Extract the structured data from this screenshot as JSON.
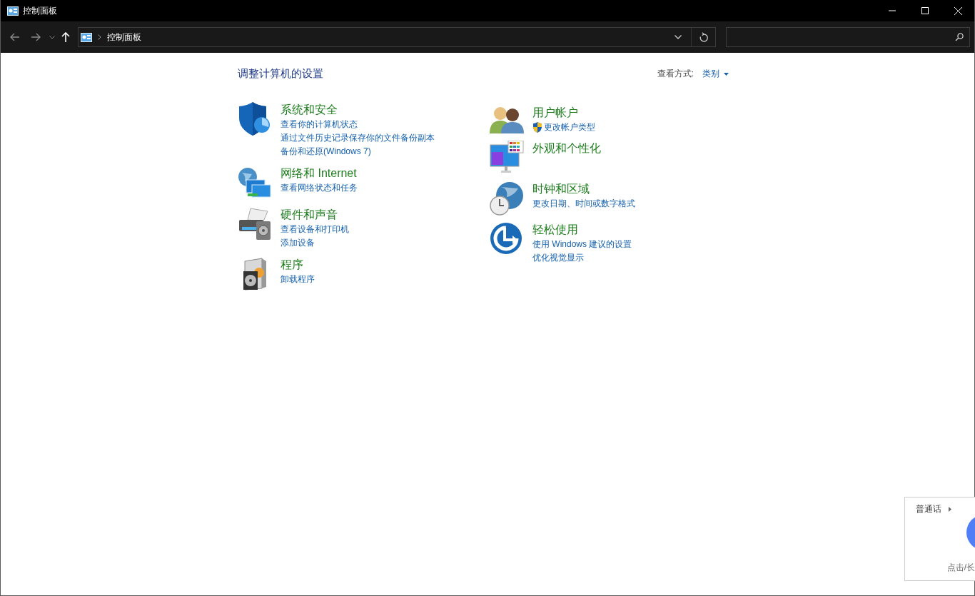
{
  "window": {
    "title": "控制面板"
  },
  "address_bar": {
    "path": [
      "控制面板"
    ]
  },
  "content": {
    "heading": "调整计算机的设置",
    "view_by": {
      "label": "查看方式:",
      "value": "类别"
    }
  },
  "columns": [
    [
      {
        "kind": "security",
        "title": "系统和安全",
        "links": [
          {
            "text": "查看你的计算机状态",
            "shield": false
          },
          {
            "text": "通过文件历史记录保存你的文件备份副本",
            "shield": false
          },
          {
            "text": "备份和还原(Windows 7)",
            "shield": false
          }
        ]
      },
      {
        "kind": "network",
        "title": "网络和 Internet",
        "links": [
          {
            "text": "查看网络状态和任务",
            "shield": false
          }
        ]
      },
      {
        "kind": "hardware",
        "title": "硬件和声音",
        "links": [
          {
            "text": "查看设备和打印机",
            "shield": false
          },
          {
            "text": "添加设备",
            "shield": false
          }
        ]
      },
      {
        "kind": "programs",
        "title": "程序",
        "links": [
          {
            "text": "卸载程序",
            "shield": false
          }
        ]
      }
    ],
    [
      {
        "kind": "users",
        "title": "用户帐户",
        "links": [
          {
            "text": "更改帐户类型",
            "shield": true
          }
        ]
      },
      {
        "kind": "appearance",
        "title": "外观和个性化"
      },
      {
        "kind": "clock",
        "title": "时钟和区域",
        "links": [
          {
            "text": "更改日期、时间或数字格式",
            "shield": false
          }
        ]
      },
      {
        "kind": "ease",
        "title": "轻松使用",
        "links": [
          {
            "text": "使用 Windows 建议的设置",
            "shield": false
          },
          {
            "text": "优化视觉显示",
            "shield": false
          }
        ]
      }
    ]
  ],
  "ime_popup": {
    "language": "普通话",
    "hint": "点击/长"
  }
}
